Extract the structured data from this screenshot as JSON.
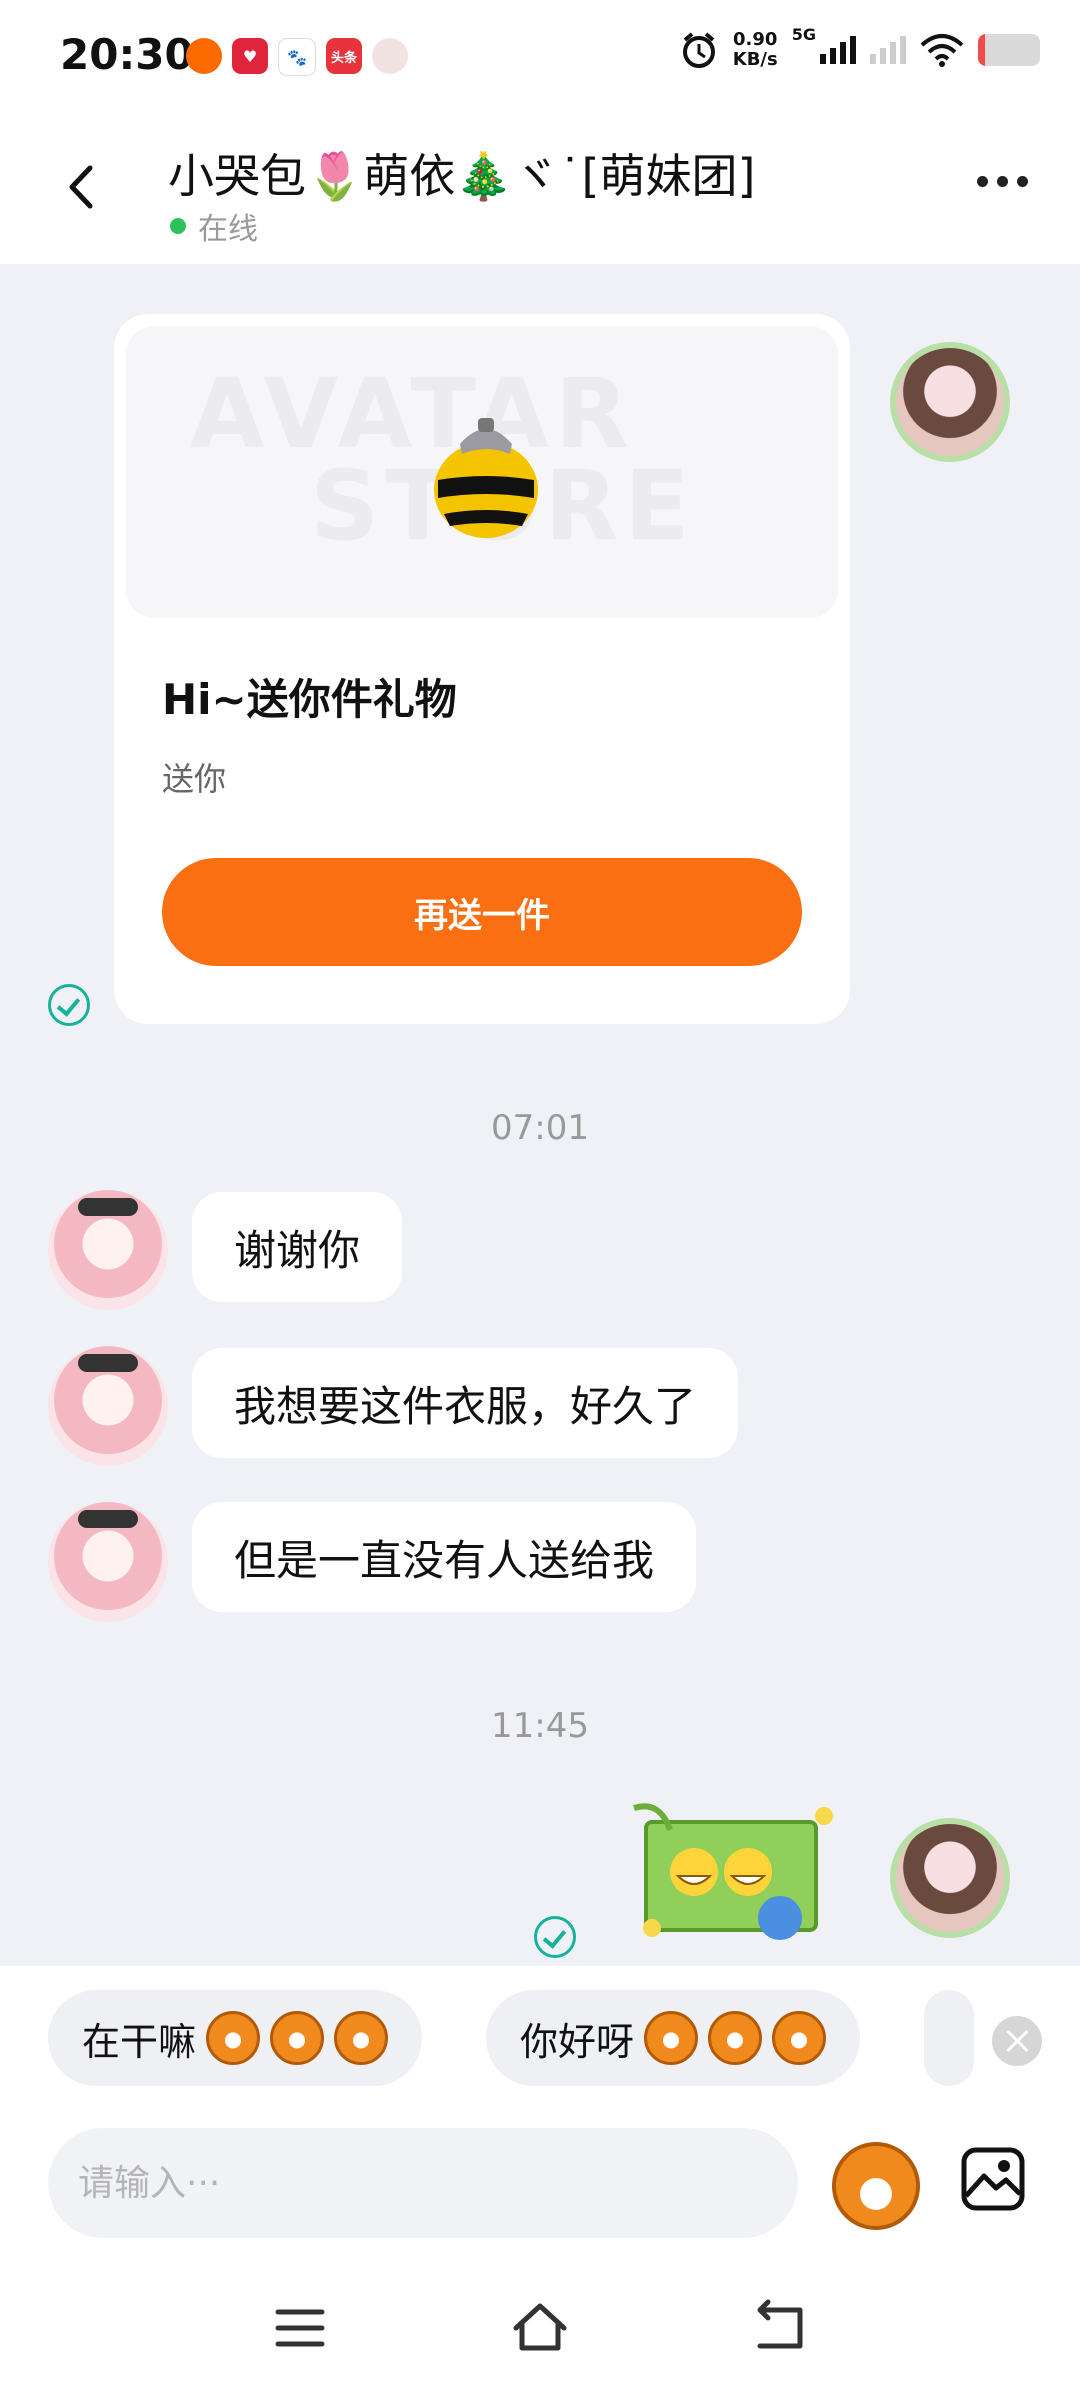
{
  "status_bar": {
    "time": "20:30",
    "net_speed_value": "0.90",
    "net_speed_unit": "KB/s",
    "network": "5G",
    "app_icons": [
      "notification-app-icon",
      "heart-app-icon",
      "baidu-app-icon",
      "toutiao-app-icon",
      "avatar-app-icon"
    ],
    "toutiao_label": "头条",
    "battery_color": "#f24a4a"
  },
  "header": {
    "title": "小哭包🌷萌依🎄ヾ˙[萌妹团]",
    "presence": "在线",
    "online_color": "#2fc25b"
  },
  "messages": {
    "gift": {
      "watermark_line1": "AVATAR",
      "watermark_line2": "STORE",
      "title": "Hi~送你件礼物",
      "subtitle": "送你",
      "button": "再送一件",
      "button_color": "#fa6f12"
    },
    "time_1": "07:01",
    "incoming": [
      "谢谢你",
      "我想要这件衣服，好久了",
      "但是一直没有人送给我"
    ],
    "time_2": "11:45",
    "sticker_icon": "grin-emoji-sticker"
  },
  "quick_replies": [
    {
      "text": "在干嘛"
    },
    {
      "text": "你好呀"
    }
  ],
  "input": {
    "placeholder": "请输入···"
  },
  "accent_check_color": "#17b29a"
}
